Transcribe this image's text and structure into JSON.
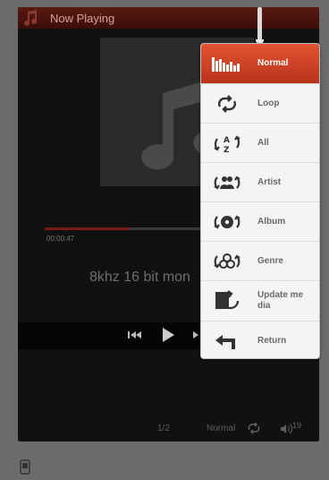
{
  "header": {
    "title": "Now Playing"
  },
  "player": {
    "elapsed": "00:00:47",
    "progress_fraction": 0.53,
    "format": "8khz 16 bit mon",
    "track_position": "1/2",
    "play_mode": "Normal",
    "volume": "19"
  },
  "menu": {
    "items": [
      {
        "label": "Normal",
        "icon": "equalizer-bars-icon",
        "active": true
      },
      {
        "label": "Loop",
        "icon": "loop-icon"
      },
      {
        "label": "All",
        "icon": "shuffle-all-az-icon"
      },
      {
        "label": "Artist",
        "icon": "shuffle-artist-icon"
      },
      {
        "label": "Album",
        "icon": "shuffle-album-icon"
      },
      {
        "label": "Genre",
        "icon": "shuffle-genre-icon"
      },
      {
        "label": "Update me dia",
        "icon": "update-media-icon"
      },
      {
        "label": "Return",
        "icon": "return-arrow-icon"
      }
    ]
  },
  "colors": {
    "accent": "#d5452a",
    "header_bg": "#4a140e",
    "menu_bg": "#f4f4f4"
  }
}
